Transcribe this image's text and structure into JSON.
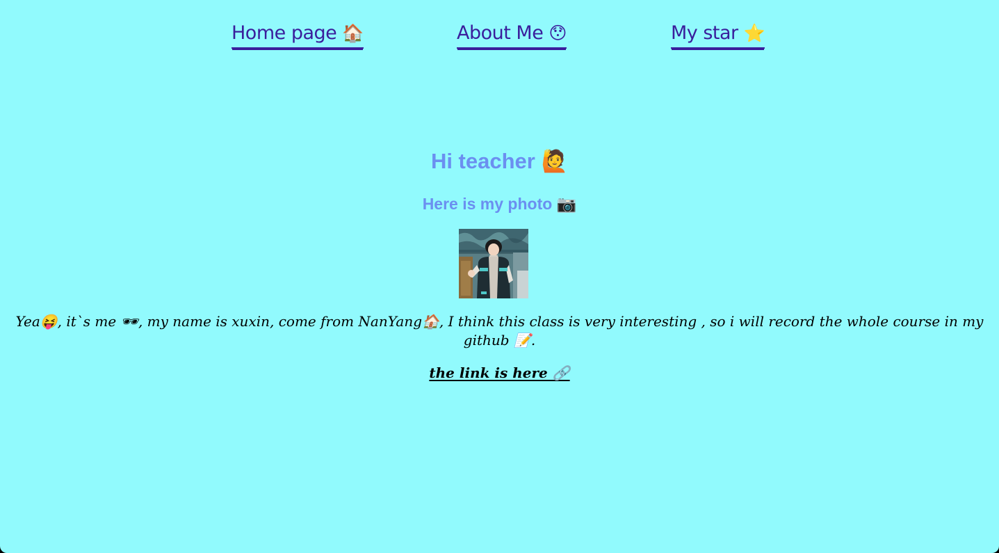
{
  "nav": {
    "home": {
      "label": "Home page",
      "emoji": "🏠"
    },
    "about": {
      "label": "About Me",
      "emoji": "😯"
    },
    "star": {
      "label": "My star",
      "emoji": "⭐"
    }
  },
  "hero": {
    "title": "Hi teacher 🙋",
    "subtitle": "Here is my photo 📷"
  },
  "intro": {
    "text": "Yea😝,  it`s me 🕶,  my name is xuxin, come from NanYang🏠, I think this class is very interesting ,  so i will record the whole course in my github 📝."
  },
  "github_link": {
    "label": "the link is here 🔗"
  },
  "colors": {
    "background": "#91fafd",
    "nav_link": "#3a1e9c",
    "heading": "#6b8ff0",
    "body_text": "#000000"
  }
}
